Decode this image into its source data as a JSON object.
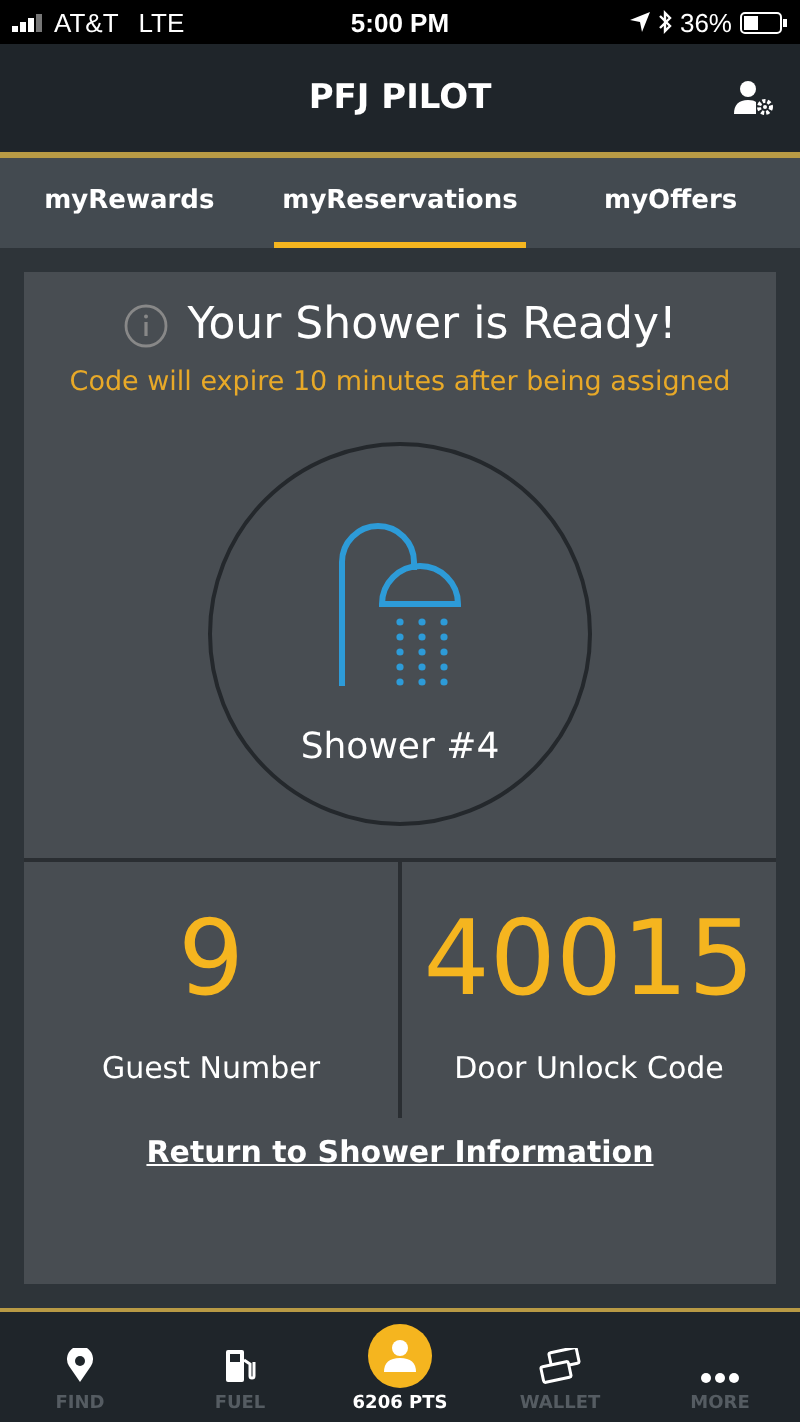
{
  "status_bar": {
    "carrier": "AT&T",
    "network": "LTE",
    "time": "5:00 PM",
    "battery": "36%"
  },
  "header": {
    "title": "PFJ PILOT"
  },
  "tabs": [
    {
      "label": "myRewards",
      "selected": false
    },
    {
      "label": "myReservations",
      "selected": true
    },
    {
      "label": "myOffers",
      "selected": false
    }
  ],
  "card": {
    "title": "Your Shower is Ready!",
    "notice": "Code will expire 10 minutes after being assigned",
    "shower": "Shower #4",
    "stats": [
      {
        "value": "9",
        "label": "Guest Number"
      },
      {
        "value": "40015",
        "label": "Door Unlock Code"
      }
    ],
    "link": "Return to Shower Information"
  },
  "nav": [
    {
      "label": "FIND",
      "selected": false
    },
    {
      "label": "FUEL",
      "selected": false
    },
    {
      "label": "6206 PTS",
      "selected": true
    },
    {
      "label": "WALLET",
      "selected": false
    },
    {
      "label": "MORE",
      "selected": false
    }
  ]
}
